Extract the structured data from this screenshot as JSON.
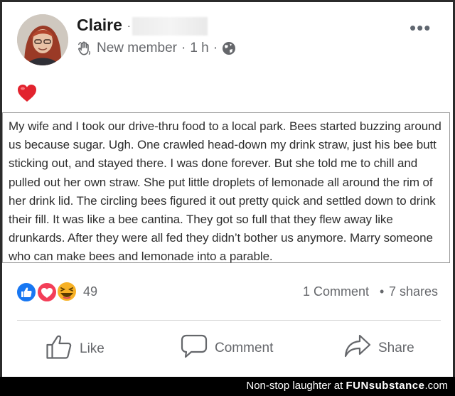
{
  "post": {
    "author": "Claire",
    "author_separator": "·",
    "badge": "New member",
    "time_separator": "·",
    "time": "1 h",
    "visibility_separator": "·",
    "more_label": "•••",
    "body": "My wife and I took our drive-thru food to a local park. Bees started buzzing around us because sugar. Ugh. One crawled head-down my drink straw, just his bee butt sticking out, and stayed there. I was done forever. But she told me to chill and pulled out her own straw. She put little droplets of lemonade all around the rim of her drink lid. The circling bees figured it out pretty quick and settled down to drink their fill. It was like a bee cantina. They got so full that they flew away like drunkards. After they were all fed they didn’t bother us anymore. Marry someone who can make bees and lemonade into a parable."
  },
  "stats": {
    "reaction_count": "49",
    "comments": "1 Comment",
    "separator": "•",
    "shares": "7 shares"
  },
  "actions": {
    "like": "Like",
    "comment": "Comment",
    "share": "Share"
  },
  "watermark": {
    "prefix": "Non-stop laughter at",
    "brand": "FUNsubstance",
    "suffix": ".com"
  },
  "colors": {
    "like_blue": "#1877f2",
    "love_red": "#f33e58",
    "haha_yellow": "#f7b125",
    "muted_text": "#65676b"
  }
}
